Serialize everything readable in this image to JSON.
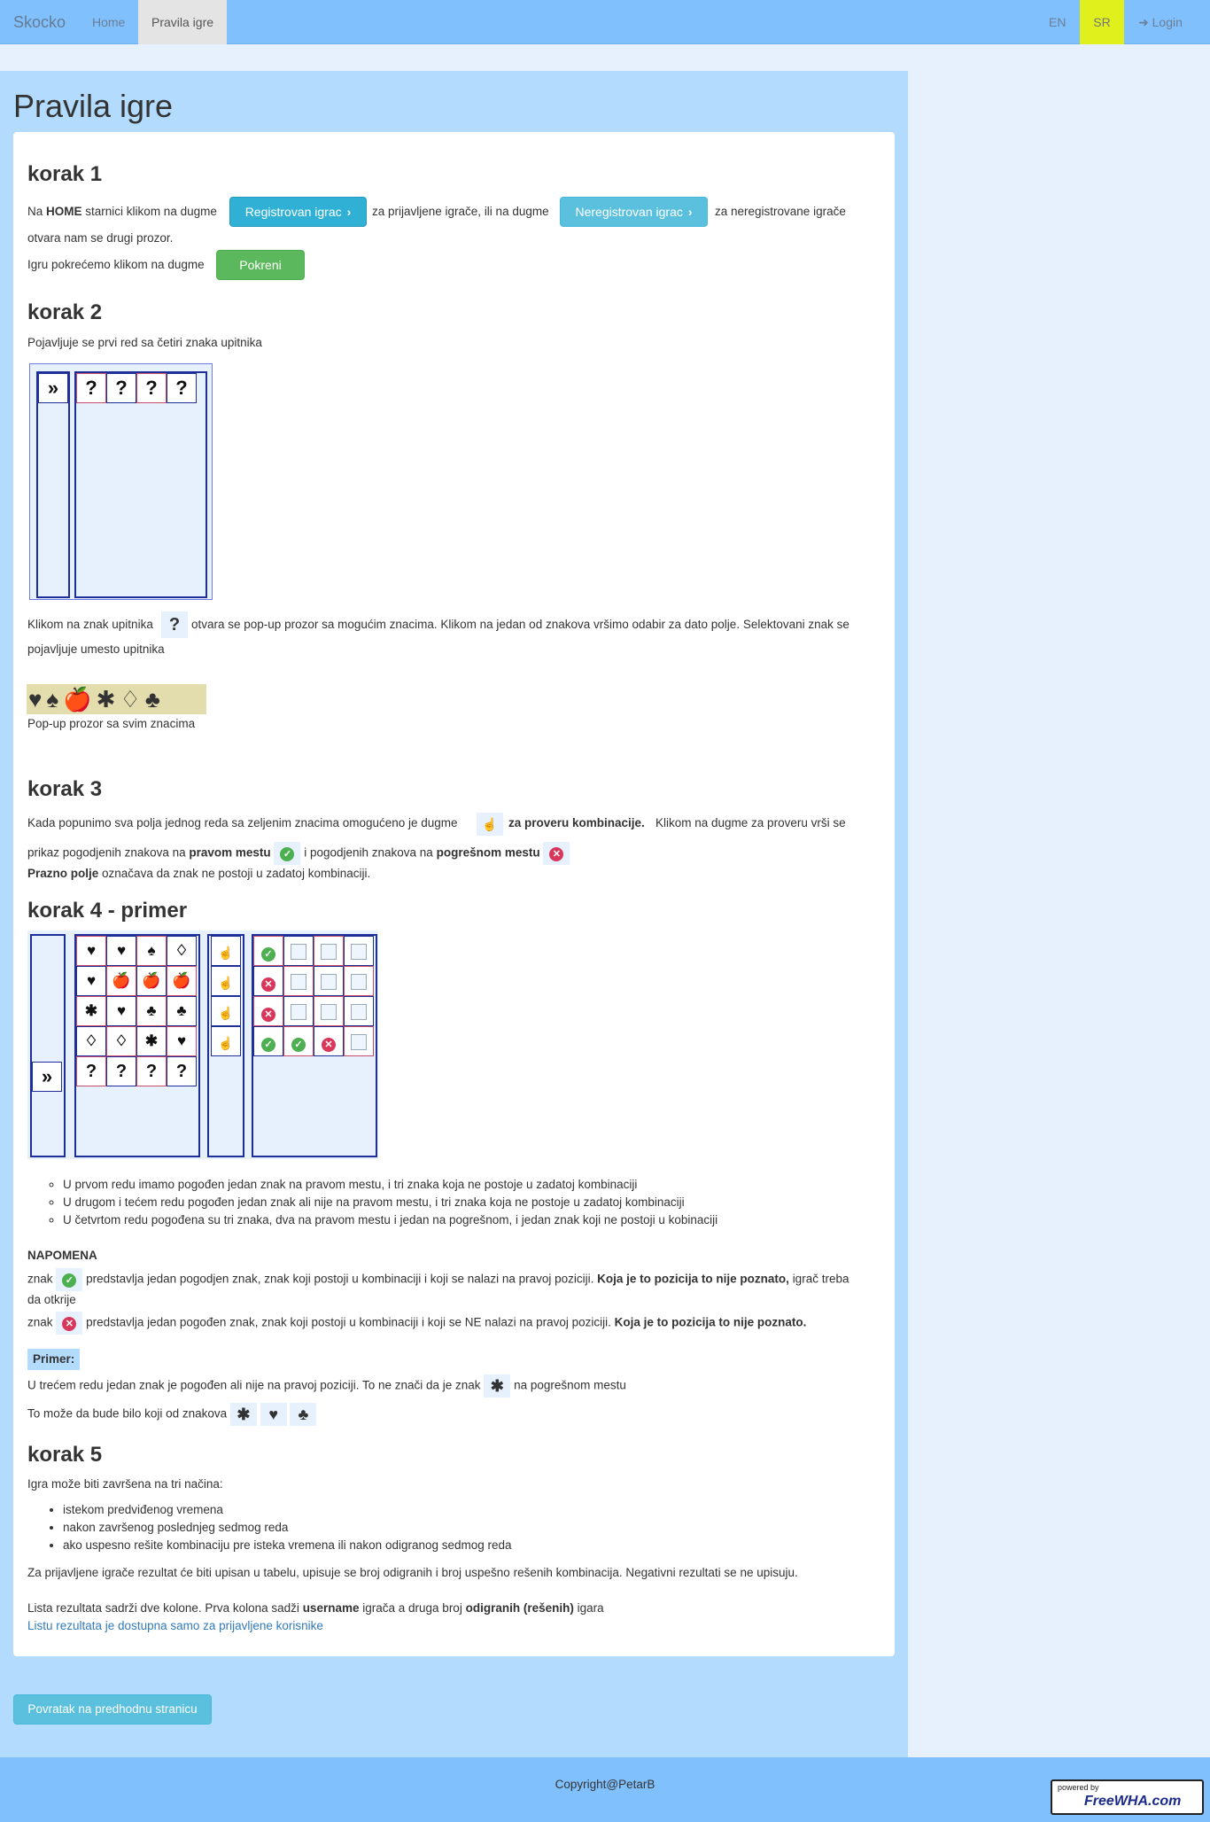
{
  "nav": {
    "brand": "Skocko",
    "home": "Home",
    "pravila": "Pravila igre",
    "en": "EN",
    "sr": "SR",
    "login": "Login"
  },
  "page_title": "Pravila igre",
  "step1": {
    "title": "korak 1",
    "t1": "Na",
    "home_bold": "HOME",
    "t2": "starnici klikom na dugme",
    "btn_registered": "Registrovan igrac",
    "t3": "za prijavljene igrače, ili na dugme",
    "btn_unregistered": "Neregistrovan igrac",
    "t4": "za neregistrovane igrače",
    "t5": "otvara nam se drugi prozor.",
    "t6": "Igru pokrećemo klikom na dugme",
    "btn_start": "Pokreni"
  },
  "step2": {
    "title": "korak 2",
    "t1": "Pojavljuje se prvi red sa četiri znaka upitnika",
    "arrow": "»",
    "q": "?",
    "t2a": "Klikom na znak upitnika",
    "t2b": "otvara se pop-up prozor sa mogućim znacima. Klikom na jedan od znakova vršimo odabir za dato polje. Selektovani znak se",
    "t2c": "pojavljuje umesto upitnika",
    "popup_symbols": "♥♠🍎✱♢♣",
    "popup_caption": "Pop-up prozor sa svim znacima"
  },
  "step3": {
    "title": "korak 3",
    "t1a": "Kada popunimo sva polja jednog reda sa zeljenim znacima omogućeno je dugme",
    "t1b": "za proveru kombinacije.",
    "t1c": "Klikom na dugme za proveru vrši se",
    "t2a": "prikaz pogodjenih znakova na",
    "t2b": "pravom mestu",
    "t2c": "i pogodjenih znakova na",
    "t2d": "pogrešnom mestu",
    "t3a": "Prazno polje",
    "t3b": "označava da znak ne postoji u zadatoj kombinaciji."
  },
  "step4": {
    "title": "korak 4 - primer",
    "grid": [
      [
        "♥",
        "♥",
        "♠",
        "♢"
      ],
      [
        "♥",
        "🍎",
        "🍎",
        "🍎"
      ],
      [
        "✱",
        "♥",
        "♣",
        "♣"
      ],
      [
        "♢",
        "♢",
        "✱",
        "♥"
      ],
      [
        "?",
        "?",
        "?",
        "?"
      ]
    ],
    "results": [
      [
        "ok",
        "",
        "",
        ""
      ],
      [
        "no",
        "",
        "",
        ""
      ],
      [
        "no",
        "",
        "",
        ""
      ],
      [
        "ok",
        "ok",
        "no",
        ""
      ]
    ],
    "list": [
      "U prvom redu imamo pogođen jedan znak na pravom mestu, i tri znaka koja ne postoje u zadatoj kombinaciji",
      "U drugom i tećem redu pogođen jedan znak ali nije na pravom mestu, i tri znaka koja ne postoje u zadatoj kombinaciji",
      "U četvrtom redu pogođena su tri znaka, dva na pravom mestu i jedan na pogrešnom, i jedan znak koji ne postoji u kobinaciji"
    ],
    "note_title": "NAPOMENA",
    "n1a": "znak",
    "n1b": "predstavlja jedan pogodjen znak, znak koji postoji u kombinaciji i koji se nalazi na pravoj poziciji.",
    "n1c": "Koja je to pozicija to nije poznato,",
    "n1d": "igrač treba",
    "n1e": "da otkrije",
    "n2a": "znak",
    "n2b": "predstavlja jedan pogođen znak, znak koji postoji u kombinaciji i koji se NE nalazi na pravoj poziciji.",
    "n2c": "Koja je to pozicija to nije poznato.",
    "primer_label": "Primer:",
    "p1a": "U trećem redu jedan znak je pogođen ali nije na pravoj poziciji. To ne znači da je znak",
    "p1b": "na pogrešnom mestu",
    "p2": "To može da bude bilo koji od znakova",
    "asterisk": "✱",
    "heart": "♥",
    "club": "♣"
  },
  "step5": {
    "title": "korak 5",
    "t1": "Igra može biti završena na tri načina:",
    "list": [
      "istekom predviđenog vremena",
      "nakon završenog poslednjeg sedmog reda",
      "ako uspesno rešite kombinaciju pre isteka vremena ili nakon odigranog sedmog reda"
    ],
    "t2": "Za prijavljene igrače rezultat će biti upisan u tabelu, upisuje se broj odigranih i broj uspešno rešenih kombinacija. Negativni rezultati se ne upisuju.",
    "t3a": "Lista rezultata sadrži dve kolone. Prva kolona sadži",
    "t3b": "username",
    "t3c": "igrača a druga broj",
    "t3d": "odigranih (rešenih)",
    "t3e": "igara",
    "link": "Listu rezultata je dostupna samo za prijavljene korisnike"
  },
  "back_button": "Povratak na predhodnu stranicu",
  "footer": {
    "copyright": "Copyright@PetarB",
    "badge_top": "powered by",
    "badge_main": "FreeWHA.com"
  }
}
